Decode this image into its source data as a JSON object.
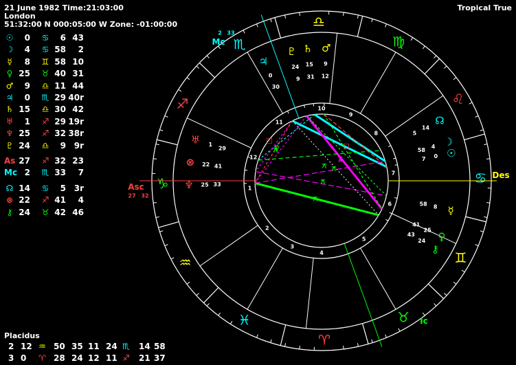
{
  "header": {
    "date_time": "21 June 1982 Time:21:03:00",
    "place": "London",
    "coords": "51:32:00 N 000:05:00 W  Zone: -01:00:00",
    "zodiac": "Tropical True"
  },
  "positions": [
    {
      "glyph": "☉",
      "deg": "0",
      "sign": "♋",
      "min": "6",
      "sec": "43",
      "color": "#00ffff",
      "sign_color": "#00ffff"
    },
    {
      "glyph": "☽",
      "deg": "4",
      "sign": "♋",
      "min": "58",
      "sec": "2",
      "color": "#00ffff",
      "sign_color": "#00ffff"
    },
    {
      "glyph": "☿",
      "deg": "8",
      "sign": "♊",
      "min": "58",
      "sec": "10",
      "color": "#ffff00",
      "sign_color": "#ffff00"
    },
    {
      "glyph": "♀",
      "deg": "25",
      "sign": "♉",
      "min": "40",
      "sec": "31",
      "color": "#00ff00",
      "sign_color": "#00ff00"
    },
    {
      "glyph": "♂",
      "deg": "9",
      "sign": "♎",
      "min": "11",
      "sec": "44",
      "color": "#ffff00",
      "sign_color": "#ffff00"
    },
    {
      "glyph": "♃",
      "deg": "0",
      "sign": "♏",
      "min": "29",
      "sec": "40r",
      "color": "#00ffff",
      "sign_color": "#00ffff"
    },
    {
      "glyph": "♄",
      "deg": "15",
      "sign": "♎",
      "min": "30",
      "sec": "42",
      "color": "#ffff00",
      "sign_color": "#ffff00"
    },
    {
      "glyph": "♅",
      "deg": "1",
      "sign": "♐",
      "min": "29",
      "sec": "19r",
      "color": "#ff4040",
      "sign_color": "#ff4040"
    },
    {
      "glyph": "♆",
      "deg": "25",
      "sign": "♐",
      "min": "32",
      "sec": "38r",
      "color": "#ff4040",
      "sign_color": "#ff4040"
    },
    {
      "glyph": "♇",
      "deg": "24",
      "sign": "♎",
      "min": "9",
      "sec": "9r",
      "color": "#ffff00",
      "sign_color": "#ffff00"
    },
    {
      "glyph": "As",
      "deg": "27",
      "sign": "♐",
      "min": "32",
      "sec": "23",
      "color": "#ff4040",
      "sign_color": "#ff4040"
    },
    {
      "glyph": "Mc",
      "deg": "2",
      "sign": "♏",
      "min": "33",
      "sec": "7",
      "color": "#00ffff",
      "sign_color": "#00ffff"
    },
    {
      "glyph": "☊",
      "deg": "14",
      "sign": "♋",
      "min": "5",
      "sec": "3r",
      "color": "#00ffff",
      "sign_color": "#00ffff"
    },
    {
      "glyph": "⊗",
      "deg": "22",
      "sign": "♐",
      "min": "41",
      "sec": "4",
      "color": "#ff4040",
      "sign_color": "#ff4040"
    },
    {
      "glyph": "⚷",
      "deg": "24",
      "sign": "♉",
      "min": "42",
      "sec": "46",
      "color": "#00ff00",
      "sign_color": "#00ff00"
    }
  ],
  "houses": {
    "system": "Placidus",
    "rows": [
      {
        "h1": "2",
        "d1": "12",
        "s1": "♒",
        "m1": "50",
        "h2": "35",
        "d2": "11",
        "h3": "24",
        "s3": "♏",
        "d3": "14",
        "m3": "58",
        "s1c": "#ffff00",
        "s3c": "#00ffff"
      },
      {
        "h1": "3",
        "d1": "0",
        "s1": "♈",
        "m1": "28",
        "h2": "24",
        "d2": "12",
        "h3": "11",
        "s3": "♐",
        "d3": "21",
        "m3": "37",
        "s1c": "#ff4040",
        "s3c": "#ff4040"
      }
    ]
  },
  "wheel": {
    "asc_label": "Asc",
    "asc_deg": "27",
    "asc_min": "32",
    "mc_label": "Mc",
    "mc_deg": "2",
    "mc_min": "33",
    "des_label": "Des",
    "ic_label": "Ic",
    "house_numbers": [
      "1",
      "2",
      "3",
      "4",
      "5",
      "6",
      "7",
      "8",
      "9",
      "10",
      "11",
      "12"
    ],
    "signs": [
      {
        "glyph": "♎",
        "color": "#ffff00"
      },
      {
        "glyph": "♍",
        "color": "#00ff00"
      },
      {
        "glyph": "♌",
        "color": "#ff4040"
      },
      {
        "glyph": "♋",
        "color": "#00ffff"
      },
      {
        "glyph": "♊",
        "color": "#ffff00"
      },
      {
        "glyph": "♉",
        "color": "#00ff00"
      },
      {
        "glyph": "♈",
        "color": "#ff4040"
      },
      {
        "glyph": "♓",
        "color": "#00ffff"
      },
      {
        "glyph": "♒",
        "color": "#ffff00"
      },
      {
        "glyph": "♑",
        "color": "#00ff00"
      },
      {
        "glyph": "♐",
        "color": "#ff4040"
      },
      {
        "glyph": "♏",
        "color": "#00ffff"
      }
    ],
    "planets": [
      {
        "glyph": "♃",
        "deg": "0",
        "min": "30",
        "color": "#00ffff"
      },
      {
        "glyph": "♇",
        "deg": "24",
        "min": "9",
        "color": "#ffff00"
      },
      {
        "glyph": "♄",
        "deg": "15",
        "min": "31",
        "color": "#ffff00"
      },
      {
        "glyph": "♂",
        "deg": "9",
        "min": "12",
        "color": "#ffff00"
      },
      {
        "glyph": "☊",
        "deg": "14",
        "min": "5",
        "color": "#00ffff"
      },
      {
        "glyph": "☽",
        "deg": "4",
        "min": "58",
        "color": "#00ffff"
      },
      {
        "glyph": "☉",
        "deg": "0",
        "min": "7",
        "color": "#00ffff"
      },
      {
        "glyph": "☿",
        "deg": "8",
        "min": "58",
        "color": "#ffff00"
      },
      {
        "glyph": "♀",
        "deg": "25",
        "min": "41",
        "color": "#00ff00"
      },
      {
        "glyph": "⚷",
        "deg": "24",
        "min": "43",
        "color": "#00ff00"
      },
      {
        "glyph": "♅",
        "deg": "1",
        "min": "29",
        "color": "#ff4040"
      },
      {
        "glyph": "⊗",
        "deg": "22",
        "min": "41",
        "color": "#ff4040"
      },
      {
        "glyph": "♆",
        "deg": "25",
        "min": "33",
        "color": "#ff4040"
      }
    ],
    "aspect_glyphs": [
      {
        "glyph": "□",
        "color": "#ff4040"
      },
      {
        "glyph": "⚻",
        "color": "#00ff00"
      },
      {
        "glyph": "⚻",
        "color": "#00ff00"
      },
      {
        "glyph": "⚻",
        "color": "#00ff00"
      },
      {
        "glyph": "⚻",
        "color": "#00ff00"
      },
      {
        "glyph": "⊼",
        "color": "#ff00ff"
      },
      {
        "glyph": "□",
        "color": "#ff4040"
      },
      {
        "glyph": "♀",
        "color": "#00ff00"
      },
      {
        "glyph": "⚻",
        "color": "#00ff00"
      }
    ]
  },
  "colors": {
    "red": "#ff4040",
    "cyan": "#00ffff",
    "yellow": "#ffff00",
    "green": "#00ff00",
    "magenta": "#ff00ff",
    "white": "#ffffff"
  }
}
